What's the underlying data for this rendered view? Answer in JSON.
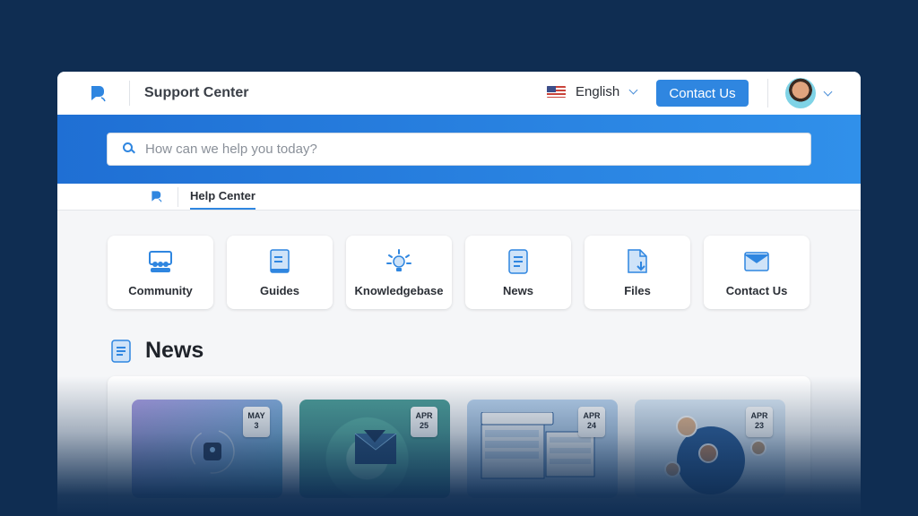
{
  "header": {
    "title": "Support Center",
    "language": "English",
    "contact_button": "Contact Us",
    "logo_icon": "logo-icon",
    "flag_icon": "us-flag-icon",
    "accent_color": "#2f86e0"
  },
  "search": {
    "placeholder": "How can we help you today?"
  },
  "subnav": {
    "tab": "Help Center"
  },
  "categories": [
    {
      "label": "Community",
      "icon": "community-icon"
    },
    {
      "label": "Guides",
      "icon": "guides-icon"
    },
    {
      "label": "Knowledgebase",
      "icon": "lightbulb-icon"
    },
    {
      "label": "News",
      "icon": "news-icon"
    },
    {
      "label": "Files",
      "icon": "file-download-icon"
    },
    {
      "label": "Contact Us",
      "icon": "envelope-icon"
    }
  ],
  "news": {
    "title": "News",
    "items": [
      {
        "month": "MAY",
        "day": "3"
      },
      {
        "month": "APR",
        "day": "25"
      },
      {
        "month": "APR",
        "day": "24"
      },
      {
        "month": "APR",
        "day": "23"
      }
    ]
  }
}
